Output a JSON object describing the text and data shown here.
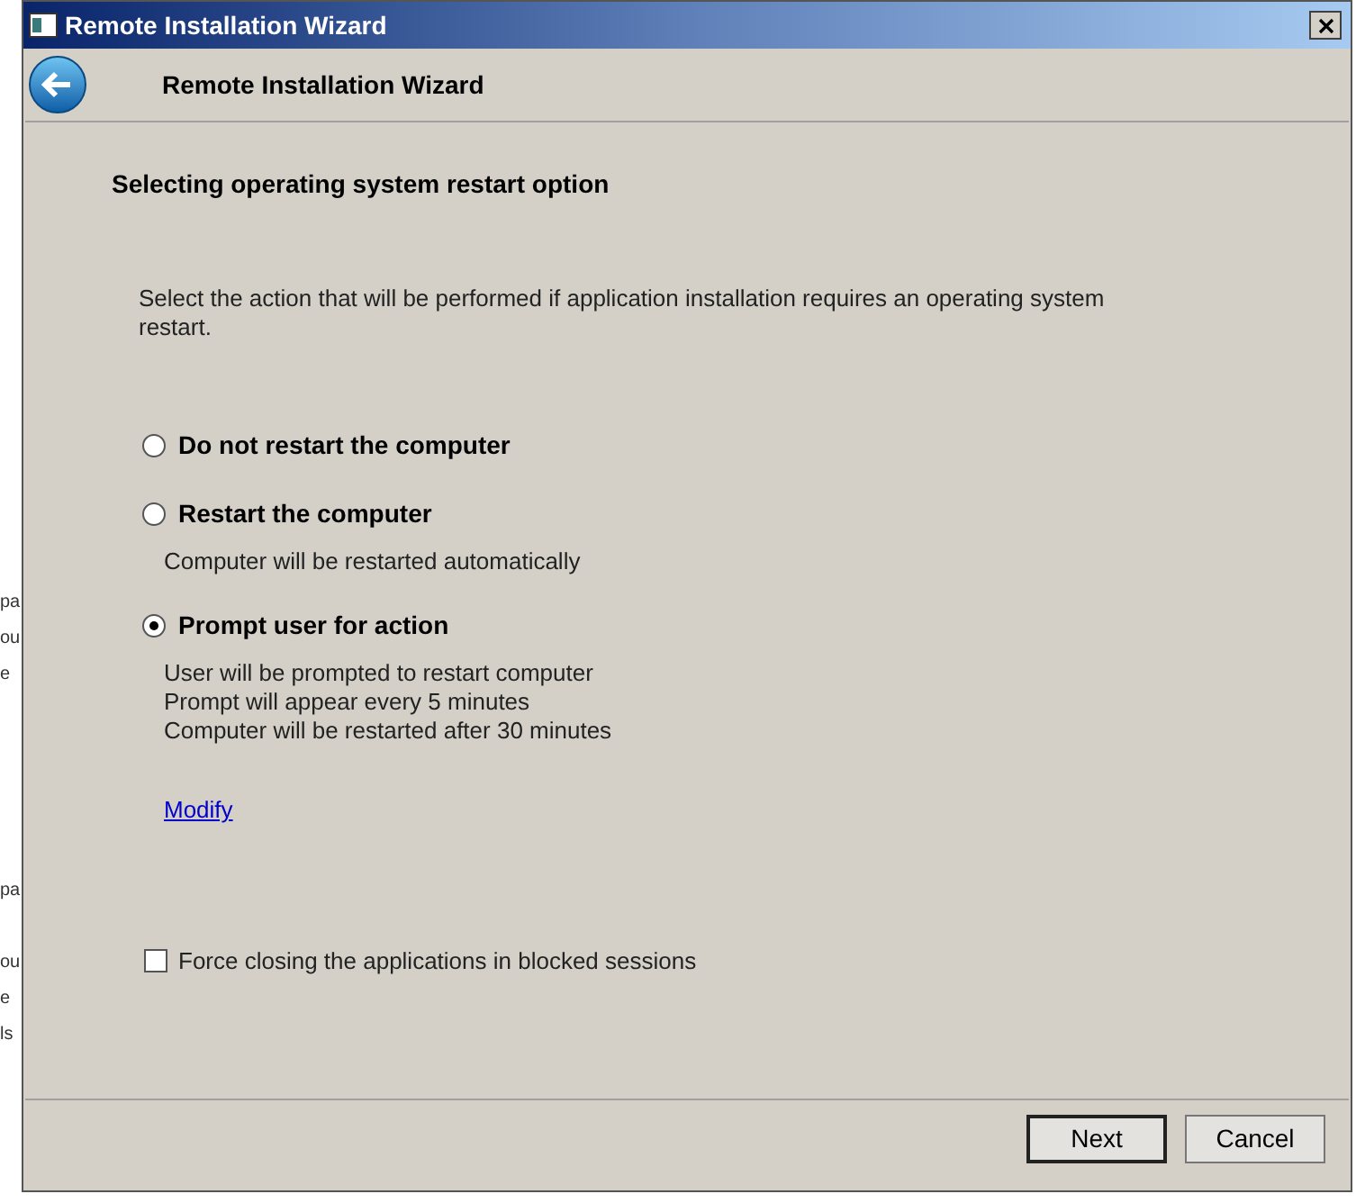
{
  "background_fragments": [
    {
      "text": "pa"
    },
    {
      "text": "ou"
    },
    {
      "text": "e"
    },
    {
      "text": "pa"
    },
    {
      "text": "ou"
    },
    {
      "text": "e"
    },
    {
      "text": "ls"
    }
  ],
  "window": {
    "title": "Remote Installation Wizard"
  },
  "header": {
    "title": "Remote Installation Wizard"
  },
  "page": {
    "heading": "Selecting operating system restart option",
    "description": "Select the action that will be performed if application installation requires an operating system restart.",
    "options": [
      {
        "label": "Do not restart the computer",
        "selected": false
      },
      {
        "label": "Restart the computer",
        "selected": false,
        "details": [
          "Computer will be restarted automatically"
        ]
      },
      {
        "label": "Prompt user for action",
        "selected": true,
        "details": [
          "User will be prompted to restart computer",
          "Prompt will appear every 5 minutes",
          "Computer will be restarted after 30 minutes"
        ],
        "link": "Modify"
      }
    ],
    "checkbox": {
      "label": "Force closing the applications in blocked sessions",
      "checked": false
    }
  },
  "buttons": [
    {
      "label": "Next",
      "default": true
    },
    {
      "label": "Cancel",
      "default": false
    }
  ]
}
